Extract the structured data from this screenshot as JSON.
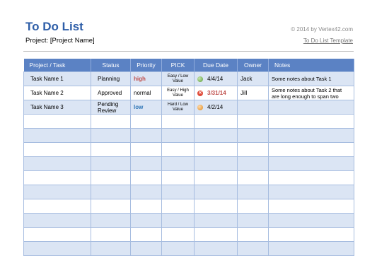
{
  "header": {
    "title": "To Do List",
    "project": "Project: [Project Name]",
    "copyright": "© 2014 by Vertex42.com",
    "template_link": "To Do List Template"
  },
  "table": {
    "columns": [
      "Project / Task",
      "Status",
      "Priority",
      "PICK",
      "Due Date",
      "Owner",
      "Notes"
    ],
    "rows": [
      {
        "task": "Task Name 1",
        "status": "Planning",
        "priority": "high",
        "pick": "Easy / Low Value",
        "due": "4/4/14",
        "due_icon": "green-circle-icon",
        "owner": "Jack",
        "notes": "Some notes about Task 1"
      },
      {
        "task": "Task Name 2",
        "status": "Approved",
        "priority": "normal",
        "pick": "Easy / High Value",
        "due": "3/31/14",
        "due_icon": "red-x-icon",
        "owner": "Jill",
        "notes": "Some notes about Task 2 that are long enough to span two"
      },
      {
        "task": "Task Name 3",
        "status": "Pending Review",
        "priority": "low",
        "pick": "Hard / Low Value",
        "due": "4/2/14",
        "due_icon": "orange-circle-icon",
        "owner": "",
        "notes": ""
      }
    ]
  },
  "colors": {
    "title": "#2e5ea8",
    "header_bg": "#5b82c4",
    "band": "#dbe5f4",
    "high": "#c0504d",
    "low": "#2e75b6"
  }
}
